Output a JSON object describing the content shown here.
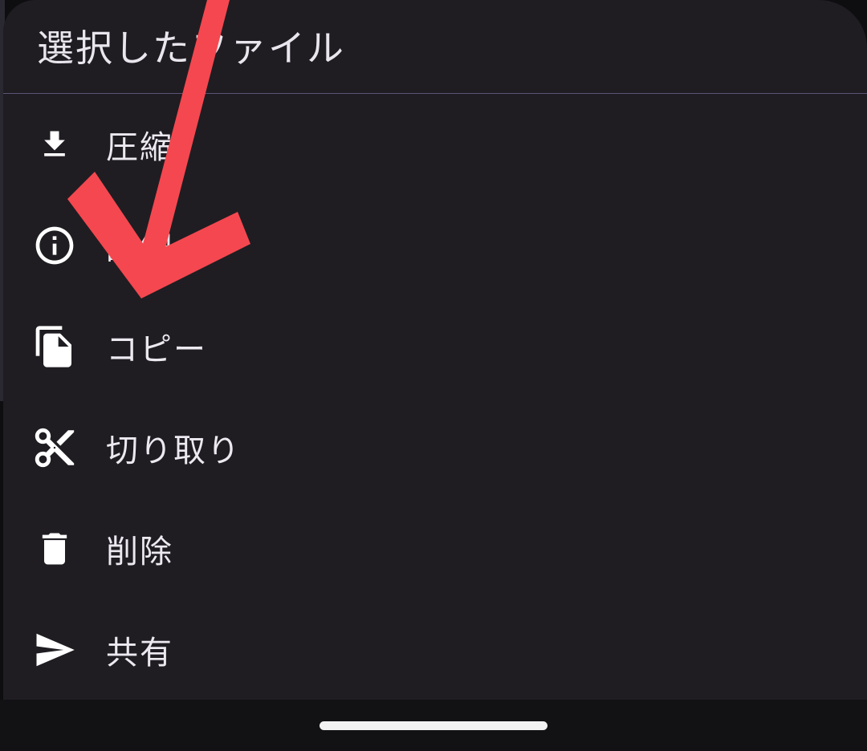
{
  "sheet": {
    "title": "選択したファイル"
  },
  "menu": {
    "items": [
      {
        "label": "圧縮",
        "icon": "download-icon"
      },
      {
        "label": "詳細",
        "icon": "info-icon"
      },
      {
        "label": "コピー",
        "icon": "copy-icon"
      },
      {
        "label": "切り取り",
        "icon": "scissors-icon"
      },
      {
        "label": "削除",
        "icon": "trash-icon"
      },
      {
        "label": "共有",
        "icon": "send-icon"
      }
    ]
  },
  "colors": {
    "sheet_background": "#1f1d22",
    "text": "#ece9f0",
    "divider": "#5a5378",
    "annotation_arrow": "#f5474f"
  }
}
